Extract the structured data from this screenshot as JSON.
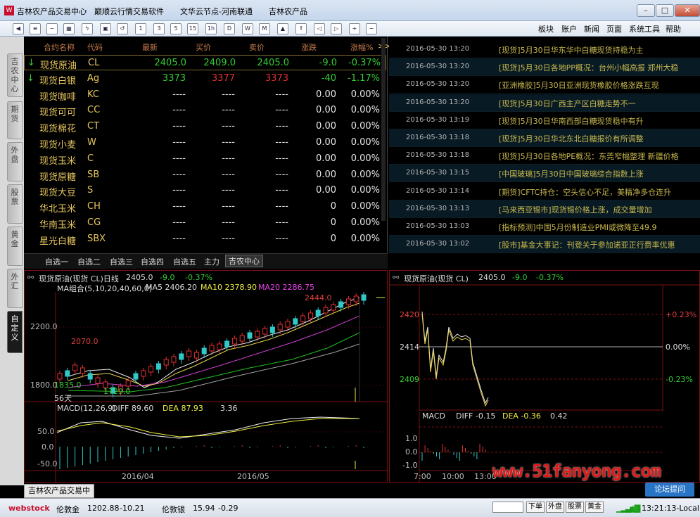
{
  "window": {
    "title": "吉林农产品交易中心",
    "tabs": [
      "吉林农产品交易中心",
      "巅顺云行情交易软件",
      "文华云节点-河南联通",
      "吉林农产品"
    ],
    "sep": "-"
  },
  "toolbar": {
    "icons": [
      "back-icon",
      "list-icon",
      "chart-icon",
      "grid-icon",
      "flash-icon",
      "save-icon",
      "refresh-icon",
      "1",
      "3",
      "5",
      "15",
      "1h",
      "day-icon",
      "week-icon",
      "month-icon",
      "up-icon",
      "prev-icon",
      "next-icon",
      "zoom-in-icon",
      "zoom-out-icon"
    ],
    "labels": [
      "1",
      "3",
      "5",
      "15",
      "1h"
    ],
    "menu": [
      "板块",
      "账户",
      "新闻",
      "页面",
      "系统工具",
      "帮助"
    ]
  },
  "left_tabs": [
    "吉农中心",
    "期货",
    "外盘",
    "股票",
    "黄金",
    "外汇",
    "自定义"
  ],
  "quote": {
    "headers": [
      "合约名称",
      "代码",
      "最新",
      "买价",
      "卖价",
      "涨跌",
      "涨幅%"
    ],
    "more": ">>",
    "rows": [
      {
        "name": "现货原油",
        "code": "CL",
        "last": "2405.0",
        "bid": "2409.0",
        "ask": "2405.0",
        "chg": "-9.0",
        "pct": "-0.37%",
        "arrow": "↓"
      },
      {
        "name": "现货白银",
        "code": "Ag",
        "last": "3373",
        "bid": "3377",
        "ask": "3373",
        "chg": "-40",
        "pct": "-1.17%",
        "arrow": "↓"
      },
      {
        "name": "现货咖啡",
        "code": "KC",
        "last": "----",
        "bid": "----",
        "ask": "----",
        "chg": "0.00",
        "pct": "0.00%",
        "arrow": ""
      },
      {
        "name": "现货可可",
        "code": "CC",
        "last": "----",
        "bid": "----",
        "ask": "----",
        "chg": "0.00",
        "pct": "0.00%",
        "arrow": ""
      },
      {
        "name": "现货棉花",
        "code": "CT",
        "last": "----",
        "bid": "----",
        "ask": "----",
        "chg": "0.00",
        "pct": "0.00%",
        "arrow": ""
      },
      {
        "name": "现货小麦",
        "code": "W",
        "last": "----",
        "bid": "----",
        "ask": "----",
        "chg": "0.00",
        "pct": "0.00%",
        "arrow": ""
      },
      {
        "name": "现货玉米",
        "code": "C",
        "last": "----",
        "bid": "----",
        "ask": "----",
        "chg": "0.00",
        "pct": "0.00%",
        "arrow": ""
      },
      {
        "name": "现货原糖",
        "code": "SB",
        "last": "----",
        "bid": "----",
        "ask": "----",
        "chg": "0.00",
        "pct": "0.00%",
        "arrow": ""
      },
      {
        "name": "现货大豆",
        "code": "S",
        "last": "----",
        "bid": "----",
        "ask": "----",
        "chg": "0.00",
        "pct": "0.00%",
        "arrow": ""
      },
      {
        "name": "华北玉米",
        "code": "CH",
        "last": "----",
        "bid": "----",
        "ask": "----",
        "chg": "0",
        "pct": "0.00%",
        "arrow": ""
      },
      {
        "name": "华南玉米",
        "code": "CG",
        "last": "----",
        "bid": "----",
        "ask": "----",
        "chg": "0",
        "pct": "0.00%",
        "arrow": ""
      },
      {
        "name": "星光白糖",
        "code": "SBX",
        "last": "----",
        "bid": "----",
        "ask": "----",
        "chg": "0",
        "pct": "0.00%",
        "arrow": ""
      }
    ],
    "tabs": [
      "自选一",
      "自选二",
      "自选三",
      "自选四",
      "自选五",
      "主力",
      "吉农中心"
    ]
  },
  "news": [
    {
      "time": "2016-05-30 13:20",
      "text": "[现货]5月30日华东华中白糖现货持稳为主"
    },
    {
      "time": "2016-05-30 13:20",
      "text": "[现货]5月30日各地PP概况：台州小幅高报 郑州大稳"
    },
    {
      "time": "2016-05-30 13:20",
      "text": "[亚洲橡胶]5月30日亚洲现货橡胶价格涨跌互现"
    },
    {
      "time": "2016-05-30 13:20",
      "text": "[现货]5月30日广西主产区白糖走势不一"
    },
    {
      "time": "2016-05-30 13:19",
      "text": "[现货]5月30日华南西部白糖现货稳中有升"
    },
    {
      "time": "2016-05-30 13:18",
      "text": "[现货]5月30日华北东北白糖报价有所调整"
    },
    {
      "time": "2016-05-30 13:18",
      "text": "[现货]5月30日各地PE概况：东莞窄幅整理 新疆价格"
    },
    {
      "time": "2016-05-30 13:15",
      "text": "[中国玻璃]5月30日中国玻璃综合指数上涨"
    },
    {
      "time": "2016-05-30 13:14",
      "text": "[期货]CFTC持仓：空头信心不足，美精净多仓连升"
    },
    {
      "time": "2016-05-30 13:13",
      "text": "[马来西亚锡市]现货锡价格上涨，成交量增加"
    },
    {
      "time": "2016-05-30 13:03",
      "text": "[指标预测]中国5月份制造业PMI或微降至49.9"
    },
    {
      "time": "2016-05-30 13:02",
      "text": "[股市]基金大事记：刊登关于参加诺亚正行费率优惠"
    }
  ],
  "kchart": {
    "title": "现货原油(现货 CL)日线",
    "last": "2405.0",
    "chg": "-9.0",
    "pct": "-0.37%",
    "ma_label": "MA组合(5,10,20,40,60,0)",
    "ma5": "MA5 2406.20",
    "ma10": "MA10 2378.90",
    "ma20": "MA20 2286.75",
    "y_ticks": [
      "2200.0",
      "1800.0"
    ],
    "hi_label": "2070.0",
    "hi2": "2444.0",
    "lo_label": "1729.0",
    "left_label": "1835.0",
    "days": "56天",
    "macd_label": "MACD(12,26,9)",
    "diff": "DIFF 89.60",
    "dea": "DEA 87.93",
    "macd": "3.36",
    "macd_ticks": [
      "50.0",
      "0.0",
      "-50.0"
    ],
    "dates": [
      "2016/04",
      "2016/05"
    ]
  },
  "chart_data": {
    "type": "line",
    "x": [
      "7:00",
      "10:00",
      "13:00"
    ],
    "ylim": [
      2406,
      2424
    ],
    "y_ticks": [
      "2420",
      "2414",
      "2409"
    ],
    "right_ticks": [
      "+0.23%",
      "0.00%",
      "-0.23%"
    ],
    "macd_ticks": [
      "1.0",
      "0.0",
      "-1.0"
    ]
  },
  "mchart": {
    "title": "现货原油(现货 CL)",
    "last": "2405.0",
    "chg": "-9.0",
    "pct": "-0.37%",
    "macd": "MACD",
    "diff": "DIFF -0.15",
    "dea": "DEA -0.36",
    "val": "0.42"
  },
  "bottom_tab": "吉林农产品交易中心",
  "status": {
    "brand": "webstock",
    "t1": "伦敦金",
    "t1v": "1202.88",
    "t1c": "-10.21",
    "t2": "伦敦银",
    "t2v": "15.94",
    "t2c": "-0.29",
    "buttons": [
      "下单",
      "外盘",
      "股票",
      "黄金"
    ],
    "time": "13:21:13-Local"
  },
  "watermark": "www.51fanyong.com",
  "forum": "论坛提问"
}
